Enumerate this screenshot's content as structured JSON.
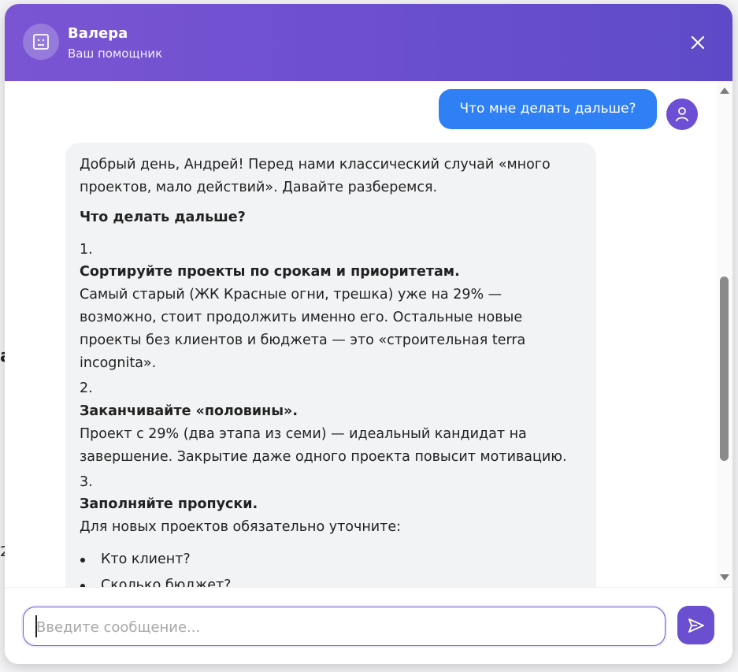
{
  "header": {
    "bot_name": "Валера",
    "bot_subtitle": "Ваш помощник",
    "avatar_icon": "bot-face-icon",
    "close_icon": "close-icon"
  },
  "colors": {
    "header_start": "#7a55d3",
    "header_end": "#5e4ac8",
    "user_bubble": "#2f80f5",
    "accent": "#6a4fd1",
    "bot_bubble": "#f2f3f5"
  },
  "messages": {
    "user_message": "Что мне делать дальше?",
    "bot": {
      "intro_1": "Добрый день, Андрей! Перед нами классический случай «много",
      "intro_2": "проектов, мало действий». Давайте разберемся.",
      "heading": "Что делать дальше?",
      "step1_num": "1.",
      "step1_title": "Сортируйте проекты по срокам и приоритетам.",
      "step1_l1": "Самый старый (ЖК Красные огни, трешка) уже на 29% —",
      "step1_l2": "возможно, стоит продолжить именно его. Остальные новые",
      "step1_l3": "проекты без клиентов и бюджета — это «строительная terra",
      "step1_l4": "incognita».",
      "step2_num": "2.",
      "step2_title": "Заканчивайте «половины».",
      "step2_l1": "Проект с 29% (два этапа из семи) — идеальный кандидат на",
      "step2_l2": "завершение. Закрытие даже одного проекта повысит мотивацию.",
      "step3_num": "3.",
      "step3_title": "Заполняйте пропуски.",
      "step3_l1": "Для новых проектов обязательно уточните:",
      "bullets": [
        "Кто клиент?",
        "Сколько бюджет?"
      ]
    }
  },
  "composer": {
    "placeholder": "Введите сообщение...",
    "send_icon": "send-icon"
  }
}
